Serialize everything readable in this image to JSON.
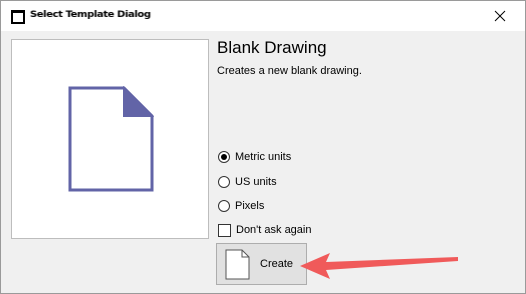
{
  "window": {
    "title": "Select Template Dialog"
  },
  "template": {
    "name": "Blank Drawing",
    "description": "Creates a new blank drawing."
  },
  "options": {
    "metric": "Metric units",
    "us": "US units",
    "pixels": "Pixels",
    "selected": "metric",
    "dont_ask_label": "Don't ask again",
    "dont_ask_checked": false
  },
  "actions": {
    "create_label": "Create"
  },
  "colors": {
    "preview_icon": "#6264a7",
    "annotation_arrow": "#f05a5a"
  }
}
